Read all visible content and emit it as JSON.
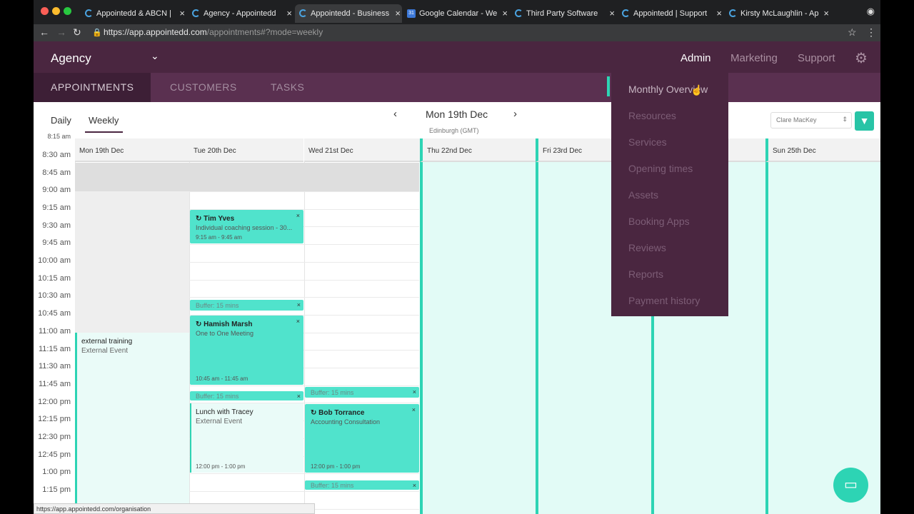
{
  "browser": {
    "tabs": [
      {
        "title": "Appointedd & ABCN |"
      },
      {
        "title": "Agency - Appointedd"
      },
      {
        "title": "Appointedd - Business"
      },
      {
        "title": "Google Calendar - We"
      },
      {
        "title": "Third Party Software"
      },
      {
        "title": "Appointedd | Support"
      },
      {
        "title": "Kirsty McLaughlin - Ap"
      }
    ],
    "url_host": "https://app.appointedd.com",
    "url_path": "/appointments#?mode=weekly",
    "status_url": "https://app.appointedd.com/organisation"
  },
  "header": {
    "org": "Agency",
    "nav": [
      "Admin",
      "Marketing",
      "Support"
    ]
  },
  "subnav": [
    "APPOINTMENTS",
    "CUSTOMERS",
    "TASKS"
  ],
  "toolbar": {
    "views": [
      "Daily",
      "Weekly"
    ],
    "date_label": "Mon 19th Dec",
    "timezone": "Edinburgh (GMT)",
    "staff": "Clare MacKey"
  },
  "days": [
    "Mon 19th Dec",
    "Tue 20th Dec",
    "Wed 21st Dec",
    "Thu 22nd Dec",
    "Fri 23rd Dec",
    "Sun 25th Dec"
  ],
  "times": [
    "8:15 am",
    "8:30 am",
    "8:45 am",
    "9:00 am",
    "9:15 am",
    "9:30 am",
    "9:45 am",
    "10:00 am",
    "10:15 am",
    "10:30 am",
    "10:45 am",
    "11:00 am",
    "11:15 am",
    "11:30 am",
    "11:45 am",
    "12:00 pm",
    "12:15 pm",
    "12:30 pm",
    "12:45 pm",
    "1:00 pm",
    "1:15 pm"
  ],
  "events": {
    "tim": {
      "name": "Tim Yves",
      "service": "Individual coaching session - 30...",
      "time": "9:15 am - 9:45 am"
    },
    "hamish": {
      "name": "Hamish Marsh",
      "service": "One to One Meeting",
      "time": "10:45 am - 11:45 am"
    },
    "bob": {
      "name": "Bob Torrance",
      "service": "Accounting Consultation",
      "time": "12:00 pm - 1:00 pm"
    },
    "training": {
      "name": "external training",
      "service": "External Event"
    },
    "lunch": {
      "name": "Lunch with Tracey",
      "service": "External Event",
      "time": "12:00 pm - 1:00 pm"
    },
    "buffer_label": "Buffer: 15 mins",
    "close": "×"
  },
  "admin_menu": [
    "Monthly Overview",
    "Resources",
    "Services",
    "Opening times",
    "Assets",
    "Booking Apps",
    "Reviews",
    "Reports",
    "Payment history"
  ],
  "colors": {
    "header": "#4a2640",
    "accent": "#2dd4b4",
    "event": "#50e3cc"
  }
}
